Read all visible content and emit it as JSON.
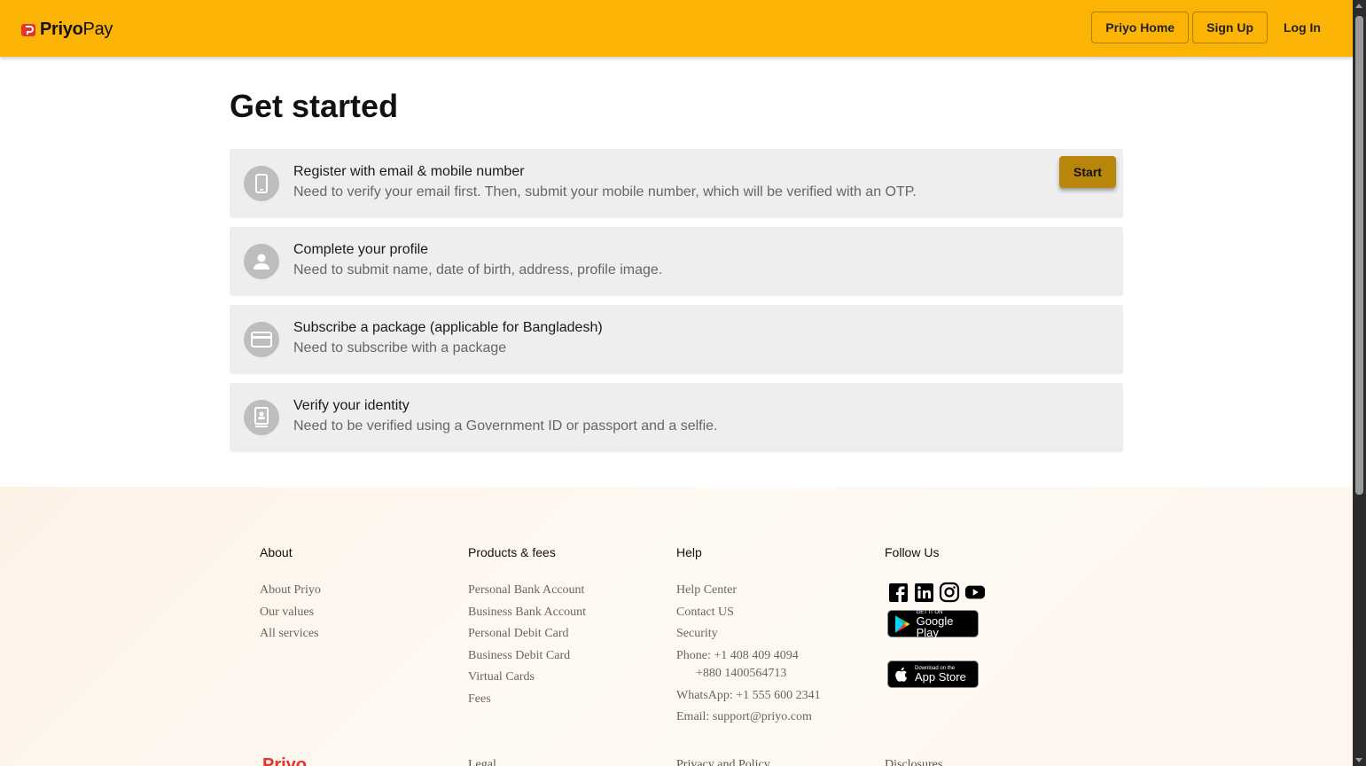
{
  "header": {
    "logo_bold": "Priyo",
    "logo_light": "Pay",
    "nav": [
      "Priyo Home",
      "Sign Up",
      "Log In"
    ]
  },
  "main": {
    "title": "Get started",
    "steps": [
      {
        "icon": "phone-icon",
        "title": "Register with email & mobile number",
        "desc": "Need to verify your email first. Then, submit your mobile number, which will be verified with an OTP.",
        "button": "Start"
      },
      {
        "icon": "person-icon",
        "title": "Complete your profile",
        "desc": "Need to submit name, date of birth, address, profile image."
      },
      {
        "icon": "card-icon",
        "title": "Subscribe a package (applicable for Bangladesh)",
        "desc": "Need to subscribe with a package"
      },
      {
        "icon": "id-badge-icon",
        "title": "Verify your identity",
        "desc": "Need to be verified using a Government ID or passport and a selfie."
      }
    ]
  },
  "footer": {
    "about": {
      "heading": "About",
      "links": [
        "About Priyo",
        "Our values",
        "All services"
      ]
    },
    "products": {
      "heading": "Products & fees",
      "links": [
        "Personal Bank Account",
        "Business Bank Account",
        "Personal Debit Card",
        "Business Debit Card",
        "Virtual Cards",
        "Fees"
      ]
    },
    "help": {
      "heading": "Help",
      "links": [
        "Help Center",
        "Contact US",
        "Security"
      ],
      "phone": "Phone: +1 408 409 4094",
      "phone2": "+880 1400564713",
      "whatsapp": "WhatsApp: +1 555 600 2341",
      "email": "Email: support@priyo.com"
    },
    "follow": {
      "heading": "Follow Us",
      "social": [
        "facebook-icon",
        "linkedin-icon",
        "instagram-icon",
        "youtube-icon"
      ],
      "google_small": "GET IT ON",
      "google_big": "Google Play",
      "apple_small": "Download on the",
      "apple_big": "App Store"
    },
    "bottom": [
      "Priyo",
      "Legal",
      "Privacy and Policy",
      "Disclosures"
    ]
  },
  "colors": {
    "header": "#fbb406",
    "start_button": "#b8860b",
    "logo_red": "#e8322d"
  }
}
